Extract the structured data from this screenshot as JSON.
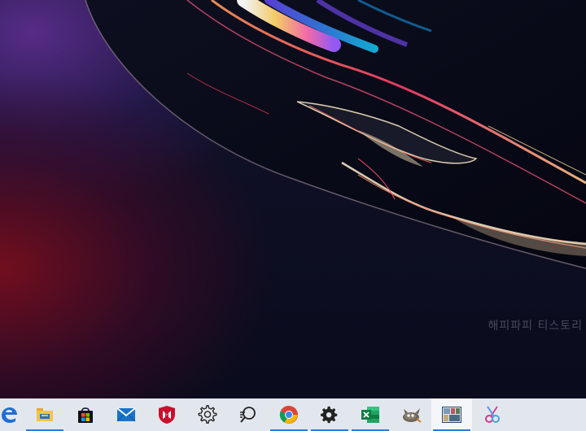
{
  "desktop": {
    "watermark": "해피파피 티스토리"
  },
  "taskbar": {
    "accent_color": "#2f7bd8",
    "background_color": "#e2e7ee",
    "items": [
      {
        "icon": "edge-icon",
        "running": false
      },
      {
        "icon": "file-explorer-icon",
        "running": true
      },
      {
        "icon": "microsoft-store-icon",
        "running": false
      },
      {
        "icon": "mail-icon",
        "running": false
      },
      {
        "icon": "mcafee-icon",
        "running": false
      },
      {
        "icon": "settings-gear-outline-icon",
        "running": false
      },
      {
        "icon": "search-feedback-icon",
        "running": false
      },
      {
        "icon": "chrome-icon",
        "running": true
      },
      {
        "icon": "settings-gear-icon",
        "running": true
      },
      {
        "icon": "excel-icon",
        "running": true
      },
      {
        "icon": "gimp-icon",
        "running": false
      },
      {
        "icon": "photo-viewer-icon",
        "running": true,
        "active": true
      },
      {
        "icon": "snipping-tool-icon",
        "running": false
      }
    ]
  }
}
